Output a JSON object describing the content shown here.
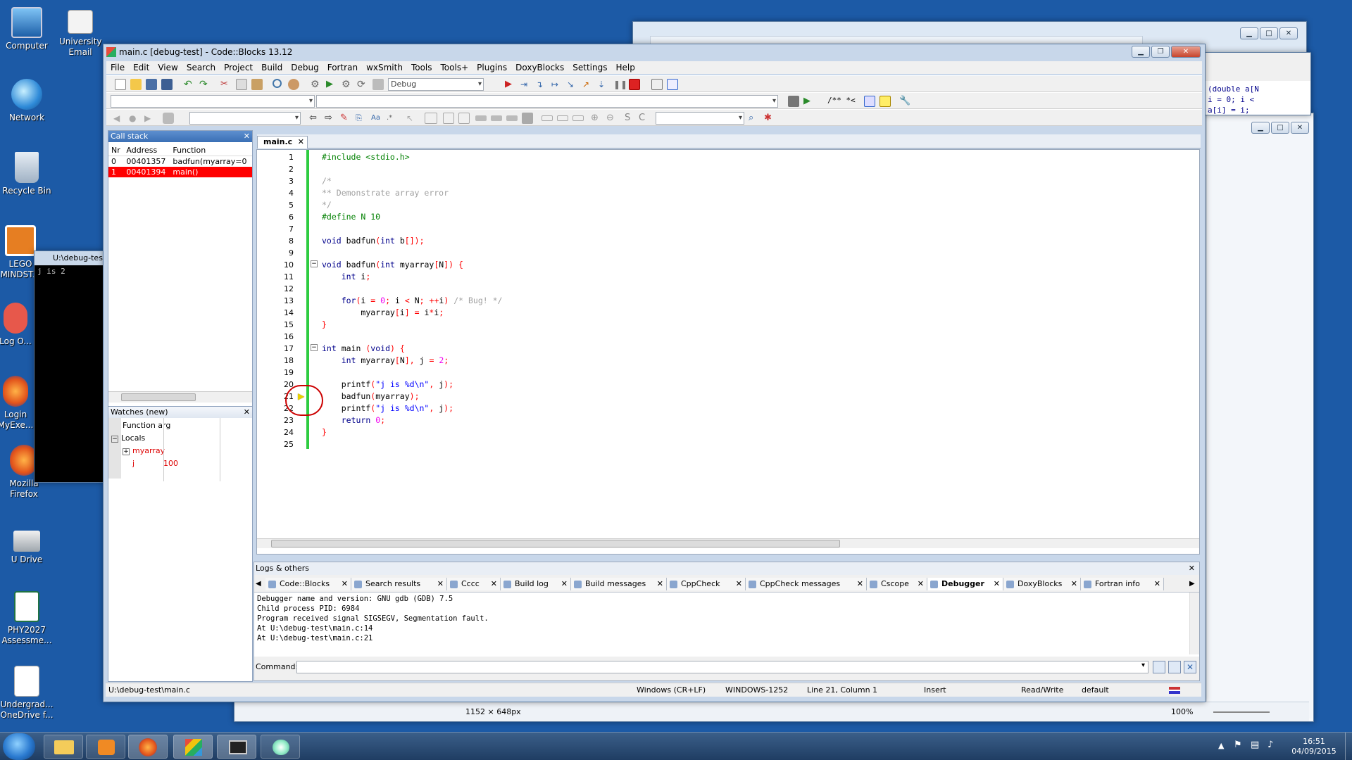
{
  "desktop": {
    "icons": [
      {
        "label": "Computer"
      },
      {
        "label": "University Email"
      },
      {
        "label": "Network"
      },
      {
        "label": "Recycle Bin"
      },
      {
        "label": "LEGO MINDST..."
      },
      {
        "label": "Log O..."
      },
      {
        "label": "Login MyExe..."
      },
      {
        "label": "Mozilla Firefox"
      },
      {
        "label": "U Drive"
      },
      {
        "label": "PHY2027 Assessme..."
      },
      {
        "label": "Undergrad... OneDrive f..."
      }
    ]
  },
  "console_window": {
    "title": "U:\\debug-tes",
    "output": "j is 2"
  },
  "background_window": {
    "code_lines": [
      "(double a[N",
      "i = 0; i <",
      "a[i] = i;"
    ],
    "status": {
      "size": "1152 × 648px",
      "zoom": "100%"
    }
  },
  "main_window": {
    "title": "main.c [debug-test] - Code::Blocks 13.12",
    "menu": [
      "File",
      "Edit",
      "View",
      "Search",
      "Project",
      "Build",
      "Debug",
      "Fortran",
      "wxSmith",
      "Tools",
      "Tools+",
      "Plugins",
      "DoxyBlocks",
      "Settings",
      "Help"
    ],
    "build_target": "Debug",
    "toolbar3_text": "/** *<",
    "call_stack": {
      "title": "Call stack",
      "columns": [
        "Nr",
        "Address",
        "Function"
      ],
      "rows": [
        {
          "nr": "0",
          "address": "00401357",
          "function": "badfun(myarray=0"
        },
        {
          "nr": "1",
          "address": "00401394",
          "function": "main()"
        }
      ]
    },
    "watches": {
      "title": "Watches (new)",
      "rows": [
        {
          "name": "Function arg",
          "value": ""
        },
        {
          "name": "Locals",
          "value": ""
        },
        {
          "name": "myarray",
          "value": ""
        },
        {
          "name": "j",
          "value": "100"
        }
      ]
    },
    "editor": {
      "tab": "main.c",
      "lines": [
        "#include <stdio.h>",
        "",
        "/*",
        "** Demonstrate array error",
        "*/",
        "#define N 10",
        "",
        "void badfun(int b[]);",
        "",
        "void badfun(int myarray[N]) {",
        "    int i;",
        "",
        "    for(i = 0; i < N; ++i) /* Bug! */",
        "        myarray[i] = i*i;",
        "}",
        "",
        "int main (void) {",
        "    int myarray[N], j = 2;",
        "",
        "    printf(\"j is %d\\n\", j);",
        "    badfun(myarray);",
        "    printf(\"j is %d\\n\", j);",
        "    return 0;",
        "}",
        ""
      ],
      "current_line": 21
    },
    "logs": {
      "title": "Logs & others",
      "tabs": [
        "Code::Blocks",
        "Search results",
        "Cccc",
        "Build log",
        "Build messages",
        "CppCheck",
        "CppCheck messages",
        "Cscope",
        "Debugger",
        "DoxyBlocks",
        "Fortran info"
      ],
      "active_tab": "Debugger",
      "output": [
        "Debugger name and version: GNU gdb (GDB) 7.5",
        "Child process PID: 6984",
        "Program received signal SIGSEGV, Segmentation fault.",
        "At U:\\debug-test\\main.c:14",
        "At U:\\debug-test\\main.c:21"
      ],
      "command_label": "Command:"
    },
    "status": {
      "file": "U:\\debug-test\\main.c",
      "eol": "Windows (CR+LF)",
      "encoding": "WINDOWS-1252",
      "position": "Line 21, Column 1",
      "mode": "Insert",
      "access": "Read/Write",
      "profile": "default"
    }
  },
  "taskbar": {
    "time": "16:51",
    "date": "04/09/2015"
  },
  "colors": {
    "desktop": "#1c5aa6",
    "highlight_row": "#ff0000",
    "change_bar": "#2ecc40",
    "annotation": "#cc0000"
  }
}
